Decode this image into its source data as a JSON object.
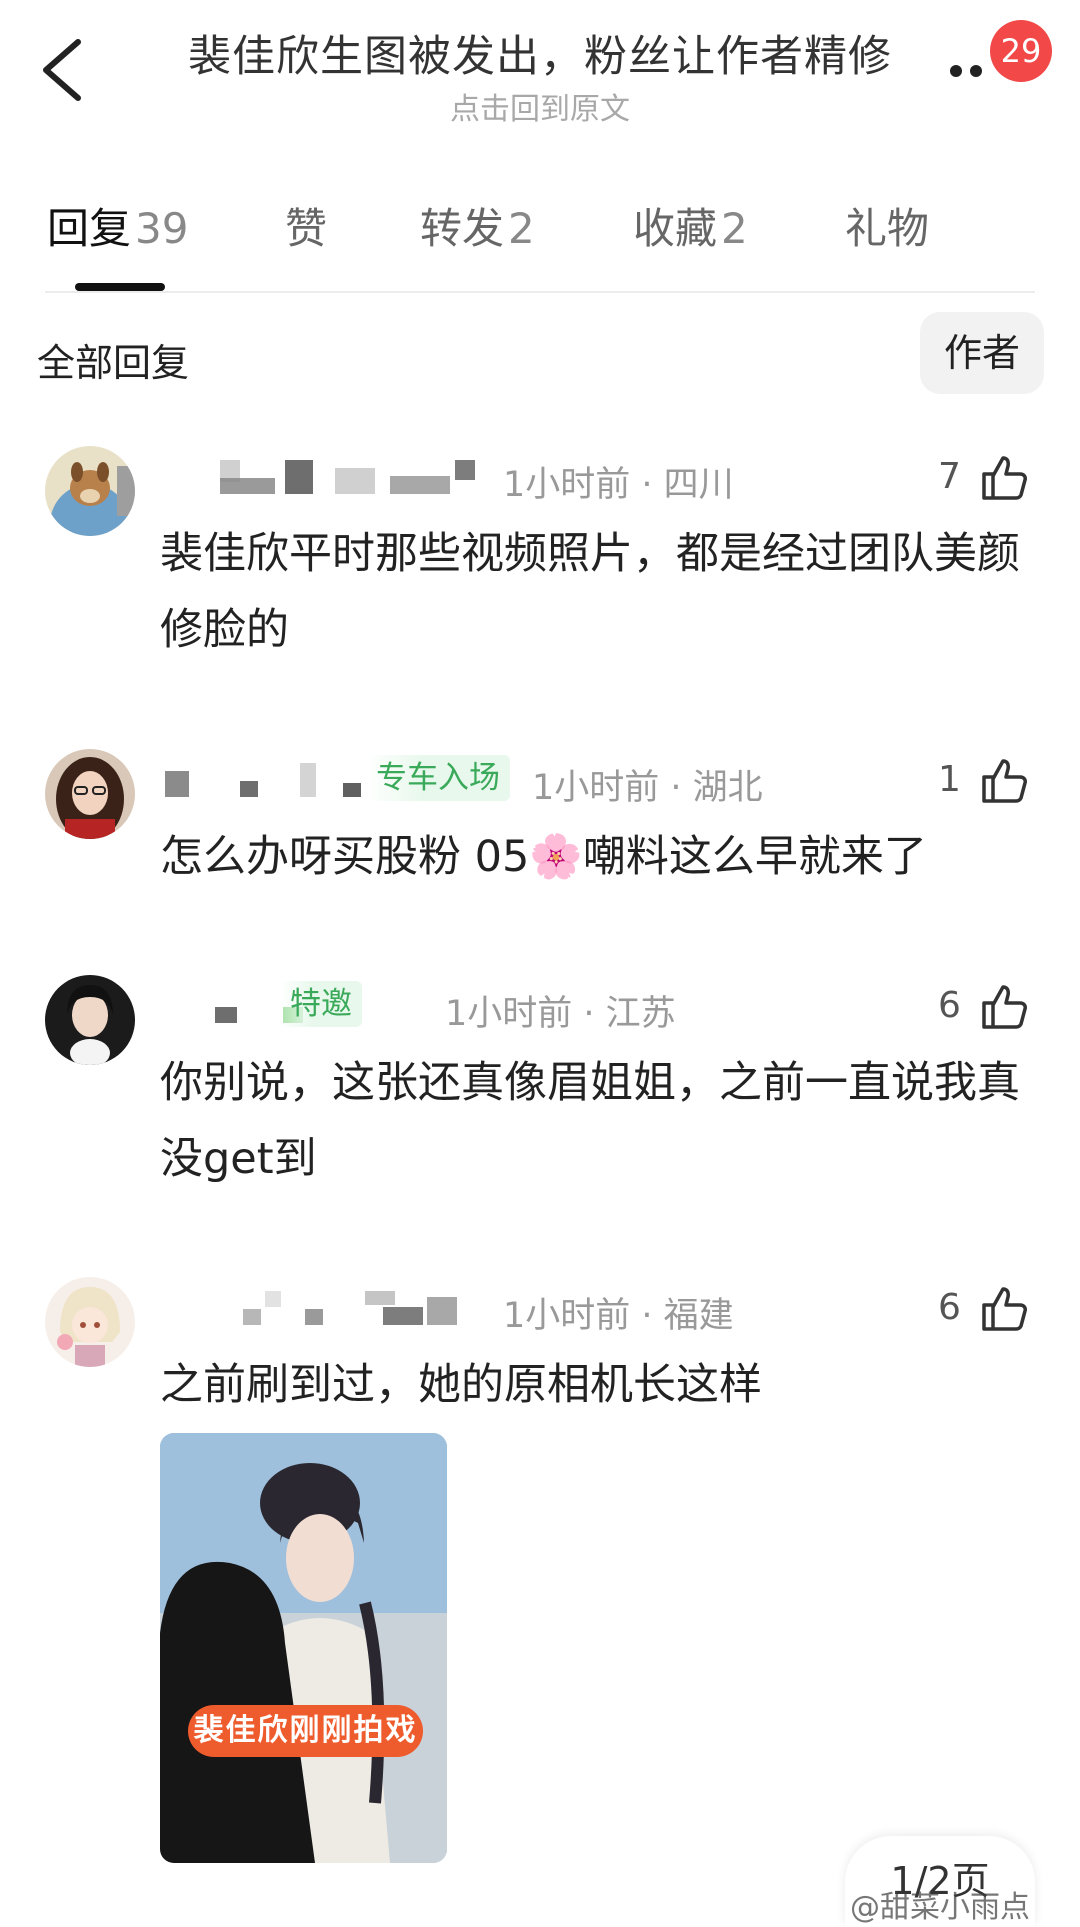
{
  "header": {
    "title": "裴佳欣生图被发出，粉丝让作者精修",
    "subtitle": "点击回到原文",
    "notification_count": "29"
  },
  "tabs": [
    {
      "label": "回复",
      "count": "39"
    },
    {
      "label": "赞",
      "count": ""
    },
    {
      "label": "转发",
      "count": "2"
    },
    {
      "label": "收藏",
      "count": "2"
    },
    {
      "label": "礼物",
      "count": ""
    }
  ],
  "filter": {
    "label": "全部回复",
    "author_button": "作者"
  },
  "comments": [
    {
      "tag": "",
      "time": "1小时前",
      "location": "四川",
      "likes": "7",
      "text": "裴佳欣平时那些视频照片，都是经过团队美颜修脸的"
    },
    {
      "tag": "专车入场",
      "time": "1小时前",
      "location": "湖北",
      "likes": "1",
      "text": "怎么办呀买股粉 05🌸嘲料这么早就来了"
    },
    {
      "tag": "特邀",
      "time": "1小时前",
      "location": "江苏",
      "likes": "6",
      "text": "你别说，这张还真像眉姐姐，之前一直说我真没get到"
    },
    {
      "tag": "",
      "time": "1小时前",
      "location": "福建",
      "likes": "6",
      "text": "之前刷到过，她的原相机长这样"
    }
  ],
  "photo_caption": "裴佳欣刚刚拍戏",
  "pagination": "1/2页",
  "watermark": "@甜菜小雨点",
  "colors": {
    "badge": "#f24848",
    "tag_green": "#3aaa5a",
    "caption_orange": "#ee5b2c"
  }
}
